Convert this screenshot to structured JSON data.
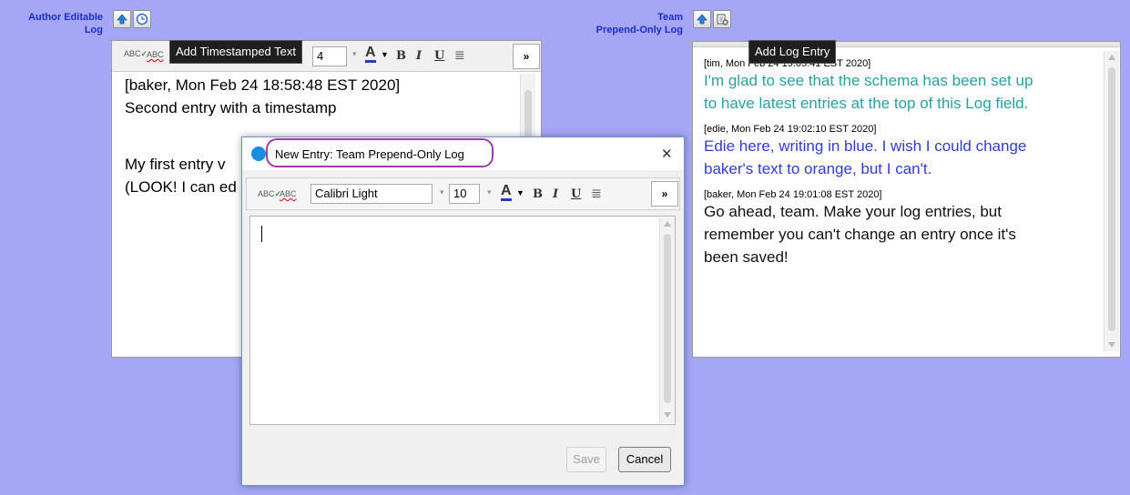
{
  "left_field": {
    "label_line1": "Author Editable",
    "label_line2": "Log",
    "tooltip": "Add Timestamped Text",
    "font_size_value": "4",
    "text_lines": [
      "[baker, Mon Feb 24 18:58:48 EST 2020]",
      "Second entry with a timestamp",
      "",
      "My first entry v",
      "(LOOK! I can ed"
    ]
  },
  "right_field": {
    "label_line1": "Team",
    "label_line2": "Prepend-Only Log",
    "tooltip": "Add Log Entry",
    "entries": [
      {
        "header": "[tim, Mon Feb 24 19:05:41 EST 2020]",
        "lines": [
          "I'm glad to see that the schema has been set up",
          "to have latest entries at the top of this Log field."
        ],
        "color": "#26a1a1"
      },
      {
        "header": "[edie, Mon Feb 24 19:02:10 EST 2020]",
        "lines": [
          "Edie here, writing in blue. I wish I could change",
          "baker's text to orange, but I can't."
        ],
        "color": "#2f3cd6"
      },
      {
        "header": "[baker, Mon Feb 24 19:01:08 EST 2020]",
        "lines": [
          "Go ahead, team. Make your log entries, but",
          "remember you can't change an entry once it's",
          "been saved!"
        ],
        "color": "#111111"
      }
    ]
  },
  "dialog": {
    "title": "New Entry:  Team Prepend-Only Log",
    "font_name": "Calibri Light",
    "font_size": "10",
    "more_label": "»",
    "save_label": "Save",
    "cancel_label": "Cancel",
    "close_label": "✕"
  },
  "colors": {
    "background": "#a6a6f7",
    "label_blue": "#1c2dc9",
    "highlight_ring": "#9b3ea6"
  }
}
